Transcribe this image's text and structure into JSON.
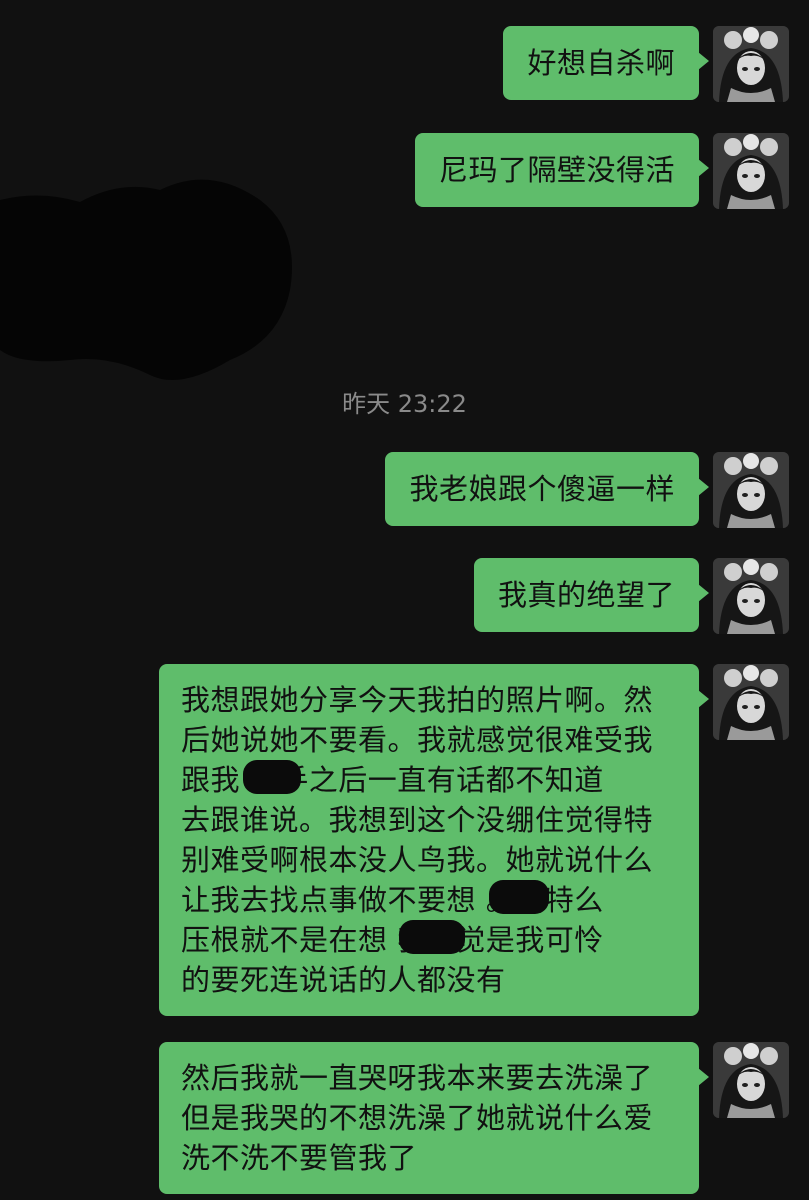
{
  "timestamp": "昨天 23:22",
  "messages": [
    {
      "text": "好想自杀啊"
    },
    {
      "text": "尼玛了隔壁没得活"
    },
    {
      "text": "我老娘跟个傻逼一样"
    },
    {
      "text": "我真的绝望了"
    },
    {
      "lines": [
        "我想跟她分享今天我拍的照片啊。然",
        "后她说她不要看。我就感觉很难受我",
        "跟我   分手之后一直有话都不知道",
        "去跟谁说。我想到这个没绷住觉得特",
        "别难受啊根本没人鸟我。她就说什么",
        "让我去找点事做不要想  。我特么",
        "压根就不是在想  我感觉是我可怜",
        "的要死连说话的人都没有"
      ]
    },
    {
      "lines": [
        "然后我就一直哭呀我本来要去洗澡了",
        "但是我哭的不想洗澡了她就说什么爱",
        "洗不洗不要管我了"
      ]
    }
  ],
  "colors": {
    "background": "#111111",
    "bubble": "#5fbd6b",
    "timestamp": "#8a8a8a"
  },
  "icons": {
    "avatar": "anime-girl-avatar-icon"
  }
}
